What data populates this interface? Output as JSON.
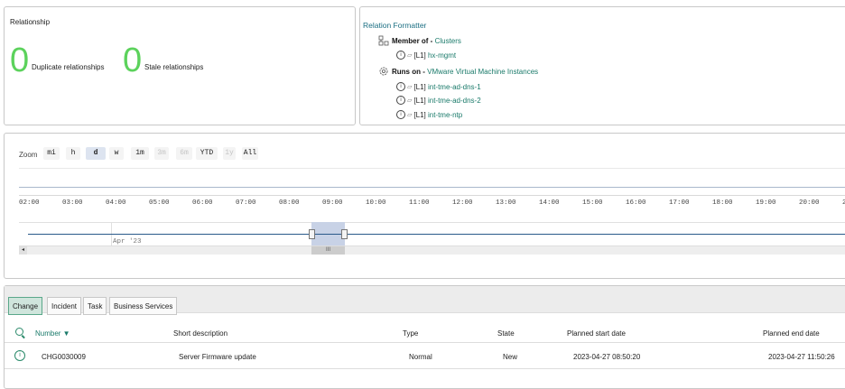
{
  "relationship": {
    "title": "Relationship",
    "duplicate_count": "0",
    "duplicate_label": "Duplicate relationships",
    "stale_count": "0",
    "stale_label": "Stale relationships"
  },
  "formatter": {
    "title": "Relation Formatter",
    "member_of_label": "Member of -",
    "member_of_target": "Clusters",
    "member_items": [
      {
        "tag": "[L1]",
        "name": "hx-mgmt"
      }
    ],
    "runs_on_label": "Runs on -",
    "runs_on_target": "VMware Virtual Machine Instances",
    "runs_items": [
      {
        "tag": "[L1]",
        "name": "int-tme-ad-dns-1"
      },
      {
        "tag": "[L1]",
        "name": "int-tme-ad-dns-2"
      },
      {
        "tag": "[L1]",
        "name": "int-tme-ntp"
      }
    ]
  },
  "timeline": {
    "zoom_label": "Zoom",
    "zoom_buttons": [
      {
        "label": "mi",
        "state": "normal"
      },
      {
        "label": "h",
        "state": "normal"
      },
      {
        "label": "d",
        "state": "selected"
      },
      {
        "label": "w",
        "state": "normal"
      },
      {
        "label": "1m",
        "state": "normal"
      },
      {
        "label": "3m",
        "state": "disabled"
      },
      {
        "label": "6m",
        "state": "disabled"
      },
      {
        "label": "YTD",
        "state": "normal"
      },
      {
        "label": "1y",
        "state": "disabled"
      },
      {
        "label": "All",
        "state": "normal"
      }
    ],
    "ticks": [
      "02:00",
      "03:00",
      "04:00",
      "05:00",
      "06:00",
      "07:00",
      "08:00",
      "09:00",
      "10:00",
      "11:00",
      "12:00",
      "13:00",
      "14:00",
      "15:00",
      "16:00",
      "17:00",
      "18:00",
      "19:00",
      "20:00",
      "21:"
    ],
    "navigator_date": "Apr '23",
    "scroll_left_glyph": "◂",
    "scroll_thumb_glyph": "III"
  },
  "tabs": [
    {
      "label": "Change",
      "active": true
    },
    {
      "label": "Incident",
      "active": false
    },
    {
      "label": "Task",
      "active": false
    },
    {
      "label": "Business Services",
      "active": false
    }
  ],
  "table": {
    "headers": {
      "number": "Number ▼",
      "short_description": "Short description",
      "type": "Type",
      "state": "State",
      "planned_start": "Planned start date",
      "planned_end": "Planned end date"
    },
    "rows": [
      {
        "number": "CHG0030009",
        "short_description": "Server Firmware update",
        "type": "Normal",
        "state": "New",
        "planned_start": "2023-04-27 08:50:20",
        "planned_end": "2023-04-27 11:50:26"
      }
    ]
  },
  "colors": {
    "count_green": "#5cd25c",
    "link_teal": "#1a7a6a",
    "active_tab_bg": "#cfe5dc"
  }
}
